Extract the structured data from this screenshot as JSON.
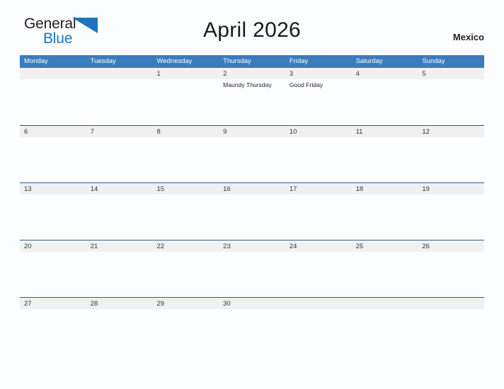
{
  "brand": {
    "name_top": "General",
    "name_bottom": "Blue",
    "flag_icon": "blue-triangle-flag-icon",
    "color_dark": "#231f20",
    "color_blue": "#1b75bb"
  },
  "header": {
    "title": "April 2026",
    "country": "Mexico"
  },
  "theme": {
    "header_blue": "#3a7cbe",
    "rule_blue": "#2a6099",
    "band_gray": "#f0f0f0",
    "page_bg": "#fcfdff"
  },
  "calendar": {
    "weekday_headers": [
      "Monday",
      "Tuesday",
      "Wednesday",
      "Thursday",
      "Friday",
      "Saturday",
      "Sunday"
    ],
    "weeks": [
      [
        {
          "date": "",
          "events": []
        },
        {
          "date": "",
          "events": []
        },
        {
          "date": "1",
          "events": []
        },
        {
          "date": "2",
          "events": [
            "Maundy Thursday"
          ]
        },
        {
          "date": "3",
          "events": [
            "Good Friday"
          ]
        },
        {
          "date": "4",
          "events": []
        },
        {
          "date": "5",
          "events": []
        }
      ],
      [
        {
          "date": "6",
          "events": []
        },
        {
          "date": "7",
          "events": []
        },
        {
          "date": "8",
          "events": []
        },
        {
          "date": "9",
          "events": []
        },
        {
          "date": "10",
          "events": []
        },
        {
          "date": "11",
          "events": []
        },
        {
          "date": "12",
          "events": []
        }
      ],
      [
        {
          "date": "13",
          "events": []
        },
        {
          "date": "14",
          "events": []
        },
        {
          "date": "15",
          "events": []
        },
        {
          "date": "16",
          "events": []
        },
        {
          "date": "17",
          "events": []
        },
        {
          "date": "18",
          "events": []
        },
        {
          "date": "19",
          "events": []
        }
      ],
      [
        {
          "date": "20",
          "events": []
        },
        {
          "date": "21",
          "events": []
        },
        {
          "date": "22",
          "events": []
        },
        {
          "date": "23",
          "events": []
        },
        {
          "date": "24",
          "events": []
        },
        {
          "date": "25",
          "events": []
        },
        {
          "date": "26",
          "events": []
        }
      ],
      [
        {
          "date": "27",
          "events": []
        },
        {
          "date": "28",
          "events": []
        },
        {
          "date": "29",
          "events": []
        },
        {
          "date": "30",
          "events": []
        },
        {
          "date": "",
          "events": []
        },
        {
          "date": "",
          "events": []
        },
        {
          "date": "",
          "events": []
        }
      ]
    ]
  }
}
